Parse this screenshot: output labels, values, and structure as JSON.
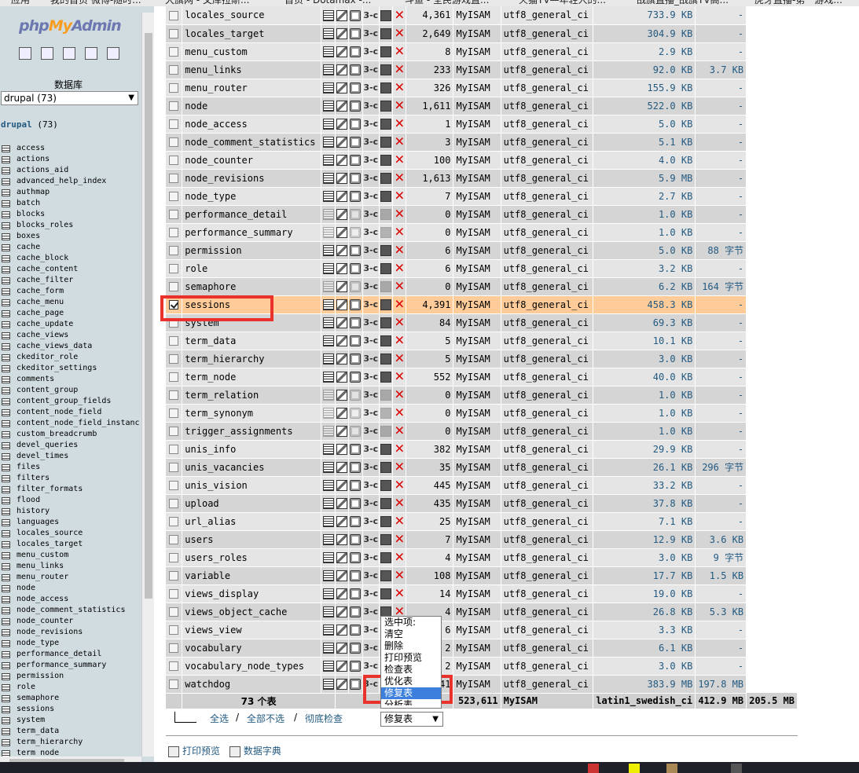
{
  "bookmarks": [
    "应用",
    "我的首页 微博-随时...",
    "大旗网 - 文库拉斯...",
    "首页 - Dotamax -...",
    "斗鱼 - 全民游戏直...",
    "火猫TV—年轻人的...",
    "战旗直播_战旗TV高...",
    "虎牙直播-第一游戏..."
  ],
  "logo": {
    "php": "php",
    "my": "My",
    "admin": "Admin"
  },
  "sidebar": {
    "db_label": "数据库",
    "db_select": "drupal (73)",
    "db_name": "drupal",
    "db_count": "(73)",
    "tables": [
      "access",
      "actions",
      "actions_aid",
      "advanced_help_index",
      "authmap",
      "batch",
      "blocks",
      "blocks_roles",
      "boxes",
      "cache",
      "cache_block",
      "cache_content",
      "cache_filter",
      "cache_form",
      "cache_menu",
      "cache_page",
      "cache_update",
      "cache_views",
      "cache_views_data",
      "ckeditor_role",
      "ckeditor_settings",
      "comments",
      "content_group",
      "content_group_fields",
      "content_node_field",
      "content_node_field_instanc",
      "custom_breadcrumb",
      "devel_queries",
      "devel_times",
      "files",
      "filters",
      "filter_formats",
      "flood",
      "history",
      "languages",
      "locales_source",
      "locales_target",
      "menu_custom",
      "menu_links",
      "menu_router",
      "node",
      "node_access",
      "node_comment_statistics",
      "node_counter",
      "node_revisions",
      "node_type",
      "performance_detail",
      "performance_summary",
      "permission",
      "role",
      "semaphore",
      "sessions",
      "system",
      "term_data",
      "term_hierarchy",
      "term_node"
    ]
  },
  "rows": [
    {
      "name": "locales_source",
      "rows": "4,361",
      "engine": "MyISAM",
      "collation": "utf8_general_ci",
      "size": "733.9 KB",
      "overhead": "-",
      "empty": false,
      "checked": false
    },
    {
      "name": "locales_target",
      "rows": "2,649",
      "engine": "MyISAM",
      "collation": "utf8_general_ci",
      "size": "304.9 KB",
      "overhead": "-",
      "empty": false,
      "checked": false
    },
    {
      "name": "menu_custom",
      "rows": "8",
      "engine": "MyISAM",
      "collation": "utf8_general_ci",
      "size": "2.9 KB",
      "overhead": "-",
      "empty": false,
      "checked": false
    },
    {
      "name": "menu_links",
      "rows": "233",
      "engine": "MyISAM",
      "collation": "utf8_general_ci",
      "size": "92.0 KB",
      "overhead": "3.7 KB",
      "empty": false,
      "checked": false
    },
    {
      "name": "menu_router",
      "rows": "326",
      "engine": "MyISAM",
      "collation": "utf8_general_ci",
      "size": "155.9 KB",
      "overhead": "-",
      "empty": false,
      "checked": false
    },
    {
      "name": "node",
      "rows": "1,611",
      "engine": "MyISAM",
      "collation": "utf8_general_ci",
      "size": "522.0 KB",
      "overhead": "-",
      "empty": false,
      "checked": false
    },
    {
      "name": "node_access",
      "rows": "1",
      "engine": "MyISAM",
      "collation": "utf8_general_ci",
      "size": "5.0 KB",
      "overhead": "-",
      "empty": false,
      "checked": false
    },
    {
      "name": "node_comment_statistics",
      "rows": "3",
      "engine": "MyISAM",
      "collation": "utf8_general_ci",
      "size": "5.1 KB",
      "overhead": "-",
      "empty": false,
      "checked": false
    },
    {
      "name": "node_counter",
      "rows": "100",
      "engine": "MyISAM",
      "collation": "utf8_general_ci",
      "size": "4.0 KB",
      "overhead": "-",
      "empty": false,
      "checked": false
    },
    {
      "name": "node_revisions",
      "rows": "1,613",
      "engine": "MyISAM",
      "collation": "utf8_general_ci",
      "size": "5.9 MB",
      "overhead": "-",
      "empty": false,
      "checked": false
    },
    {
      "name": "node_type",
      "rows": "7",
      "engine": "MyISAM",
      "collation": "utf8_general_ci",
      "size": "2.7 KB",
      "overhead": "-",
      "empty": false,
      "checked": false
    },
    {
      "name": "performance_detail",
      "rows": "0",
      "engine": "MyISAM",
      "collation": "utf8_general_ci",
      "size": "1.0 KB",
      "overhead": "-",
      "empty": true,
      "checked": false
    },
    {
      "name": "performance_summary",
      "rows": "0",
      "engine": "MyISAM",
      "collation": "utf8_general_ci",
      "size": "1.0 KB",
      "overhead": "-",
      "empty": true,
      "checked": false
    },
    {
      "name": "permission",
      "rows": "6",
      "engine": "MyISAM",
      "collation": "utf8_general_ci",
      "size": "5.0 KB",
      "overhead": "88 字节",
      "empty": false,
      "checked": false
    },
    {
      "name": "role",
      "rows": "6",
      "engine": "MyISAM",
      "collation": "utf8_general_ci",
      "size": "3.2 KB",
      "overhead": "-",
      "empty": false,
      "checked": false
    },
    {
      "name": "semaphore",
      "rows": "0",
      "engine": "MyISAM",
      "collation": "utf8_general_ci",
      "size": "6.2 KB",
      "overhead": "164 字节",
      "empty": true,
      "checked": false
    },
    {
      "name": "sessions",
      "rows": "4,391",
      "engine": "MyISAM",
      "collation": "utf8_general_ci",
      "size": "458.3 KB",
      "overhead": "-",
      "empty": false,
      "checked": true
    },
    {
      "name": "system",
      "rows": "84",
      "engine": "MyISAM",
      "collation": "utf8_general_ci",
      "size": "69.3 KB",
      "overhead": "-",
      "empty": false,
      "checked": false
    },
    {
      "name": "term_data",
      "rows": "5",
      "engine": "MyISAM",
      "collation": "utf8_general_ci",
      "size": "10.1 KB",
      "overhead": "-",
      "empty": false,
      "checked": false
    },
    {
      "name": "term_hierarchy",
      "rows": "5",
      "engine": "MyISAM",
      "collation": "utf8_general_ci",
      "size": "3.0 KB",
      "overhead": "-",
      "empty": false,
      "checked": false
    },
    {
      "name": "term_node",
      "rows": "552",
      "engine": "MyISAM",
      "collation": "utf8_general_ci",
      "size": "40.0 KB",
      "overhead": "-",
      "empty": false,
      "checked": false
    },
    {
      "name": "term_relation",
      "rows": "0",
      "engine": "MyISAM",
      "collation": "utf8_general_ci",
      "size": "1.0 KB",
      "overhead": "-",
      "empty": true,
      "checked": false
    },
    {
      "name": "term_synonym",
      "rows": "0",
      "engine": "MyISAM",
      "collation": "utf8_general_ci",
      "size": "1.0 KB",
      "overhead": "-",
      "empty": true,
      "checked": false
    },
    {
      "name": "trigger_assignments",
      "rows": "0",
      "engine": "MyISAM",
      "collation": "utf8_general_ci",
      "size": "1.0 KB",
      "overhead": "-",
      "empty": true,
      "checked": false
    },
    {
      "name": "unis_info",
      "rows": "382",
      "engine": "MyISAM",
      "collation": "utf8_general_ci",
      "size": "29.9 KB",
      "overhead": "-",
      "empty": false,
      "checked": false
    },
    {
      "name": "unis_vacancies",
      "rows": "35",
      "engine": "MyISAM",
      "collation": "utf8_general_ci",
      "size": "26.1 KB",
      "overhead": "296 字节",
      "empty": false,
      "checked": false
    },
    {
      "name": "unis_vision",
      "rows": "445",
      "engine": "MyISAM",
      "collation": "utf8_general_ci",
      "size": "33.2 KB",
      "overhead": "-",
      "empty": false,
      "checked": false
    },
    {
      "name": "upload",
      "rows": "435",
      "engine": "MyISAM",
      "collation": "utf8_general_ci",
      "size": "37.8 KB",
      "overhead": "-",
      "empty": false,
      "checked": false
    },
    {
      "name": "url_alias",
      "rows": "25",
      "engine": "MyISAM",
      "collation": "utf8_general_ci",
      "size": "7.1 KB",
      "overhead": "-",
      "empty": false,
      "checked": false
    },
    {
      "name": "users",
      "rows": "7",
      "engine": "MyISAM",
      "collation": "utf8_general_ci",
      "size": "12.9 KB",
      "overhead": "3.6 KB",
      "empty": false,
      "checked": false
    },
    {
      "name": "users_roles",
      "rows": "4",
      "engine": "MyISAM",
      "collation": "utf8_general_ci",
      "size": "3.0 KB",
      "overhead": "9 字节",
      "empty": false,
      "checked": false
    },
    {
      "name": "variable",
      "rows": "108",
      "engine": "MyISAM",
      "collation": "utf8_general_ci",
      "size": "17.7 KB",
      "overhead": "1.5 KB",
      "empty": false,
      "checked": false
    },
    {
      "name": "views_display",
      "rows": "14",
      "engine": "MyISAM",
      "collation": "utf8_general_ci",
      "size": "19.0 KB",
      "overhead": "-",
      "empty": false,
      "checked": false
    },
    {
      "name": "views_object_cache",
      "rows": "4",
      "engine": "MyISAM",
      "collation": "utf8_general_ci",
      "size": "26.8 KB",
      "overhead": "5.3 KB",
      "empty": false,
      "checked": false
    },
    {
      "name": "views_view",
      "rows": "6",
      "engine": "MyISAM",
      "collation": "utf8_general_ci",
      "size": "3.3 KB",
      "overhead": "-",
      "empty": false,
      "checked": false
    },
    {
      "name": "vocabulary",
      "rows": "2",
      "engine": "MyISAM",
      "collation": "utf8_general_ci",
      "size": "6.1 KB",
      "overhead": "-",
      "empty": false,
      "checked": false
    },
    {
      "name": "vocabulary_node_types",
      "rows": "2",
      "engine": "MyISAM",
      "collation": "utf8_general_ci",
      "size": "3.0 KB",
      "overhead": "-",
      "empty": false,
      "checked": false
    },
    {
      "name": "watchdog",
      "rows": "496,741",
      "engine": "MyISAM",
      "collation": "utf8_general_ci",
      "size": "383.9 MB",
      "overhead": "197.8 MB",
      "empty": false,
      "checked": false
    }
  ],
  "footer": {
    "count": "73 个表",
    "rows": "523,611",
    "engine": "MyISAM",
    "collation": "latin1_swedish_ci",
    "size": "412.9 MB",
    "overhead": "205.5 MB"
  },
  "bottom": {
    "select_all": "全选",
    "sep1": "/",
    "deselect_all": "全部不选",
    "sep2": "/",
    "check_overhead": "彻底检查"
  },
  "dropdown": {
    "options": [
      "选中项:",
      "清空",
      "删除",
      "打印预览",
      "检查表",
      "优化表",
      "修复表",
      "分析表"
    ],
    "selected": "修复表"
  },
  "select_value": "修复表",
  "links": {
    "print": "打印预览",
    "dict": "数据字典"
  },
  "colors": {
    "marked_row": "#ffcc99",
    "highlight": "#e8322b",
    "link": "#235a81",
    "select": "#3c7fdc"
  }
}
